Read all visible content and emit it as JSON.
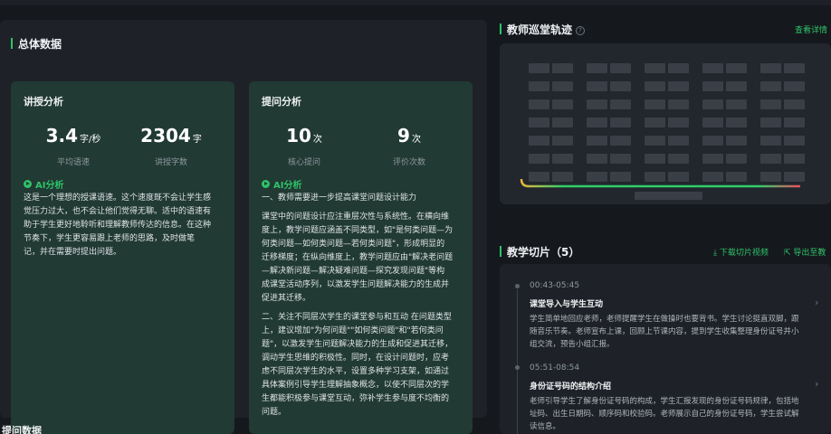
{
  "overview": {
    "title": "总体数据",
    "lecture": {
      "title": "讲授分析",
      "stats": [
        {
          "value": "3.4",
          "unit": "字/秒",
          "label": "平均语速"
        },
        {
          "value": "2304",
          "unit": "字",
          "label": "讲授字数"
        }
      ],
      "ai_label": "AI分析",
      "ai_text": "这是一个理想的授课语速。这个速度既不会让学生感\n觉压力过大，也不会让他们觉得无聊。适中的语速有\n助于学生更好地聆听和理解教师传达的信息。在这种\n节奏下，学生更容易跟上老师的思路，及时做笔\n记，并在需要时提出问题。"
    },
    "question": {
      "title": "提问分析",
      "stats": [
        {
          "value": "10",
          "unit": "次",
          "label": "核心提问"
        },
        {
          "value": "9",
          "unit": "次",
          "label": "评价次数"
        }
      ],
      "ai_label": "AI分析",
      "ai_heading": "一、教师需要进一步提高课堂问题设计能力",
      "ai_para1": "课堂中的问题设计应注重层次性与系统性。在横向维\n度上，教学问题应涵盖不同类型，如\"是何类问题—为\n何类问题—如何类问题—若何类问题\"，形成明显的\n迁移梯度；在纵向维度上，教学问题应由\"解决老问题\n—解决新问题—解决疑难问题—探究发现问题\"等构\n成课堂活动序列，以激发学生问题解决能力的生成并\n促进其迁移。",
      "ai_para2": "二、关注不同层次学生的课堂参与和互动 在问题类型\n上，建议增加\"为何问题\"\"如何类问题\"和\"若何类问\n题\"，以激发学生问题解决能力的生成和促进其迁移，\n调动学生思维的积极性。同时，在设计问题时，应考\n虑不同层次学生的水平，设置多种学习支架，如通过\n具体案例引导学生理解抽象概念，以使不同层次的学\n生都能积极参与课堂互动，弥补学生参与度不均衡的\n问题。"
    }
  },
  "bottom_section": {
    "title": "提问数据"
  },
  "patrol": {
    "title": "教师巡堂轨迹",
    "help": "?",
    "link": "查看详情",
    "colors": {
      "track": "#2fd06a",
      "warm": "#e8b63a",
      "hot": "#e8505b",
      "seat": "#3a3f47"
    }
  },
  "slices": {
    "title": "教学切片（5）",
    "download": "下载切片视频",
    "export": "导出至教",
    "items": [
      {
        "time": "00:43-05:45",
        "heading": "课堂导入与学生互动",
        "desc": "学生简单地回应老师，老师提醒学生在做操时也要背书。学生讨论挺直双脚，跟\n随音乐节奏。老师宣布上课，回顾上节课内容，提到学生收集整理身份证号并小\n组交流，预告小组汇报。"
      },
      {
        "time": "05:51-08:54",
        "heading": "身份证号码的结构介绍",
        "desc": "老师引导学生了解身份证号码的构成，学生汇报发现的身份证号码规律，包括地\n址码、出生日期码、顺序码和校验码。老师展示自己的身份证号码，学生尝试解\n读信息。"
      }
    ]
  }
}
